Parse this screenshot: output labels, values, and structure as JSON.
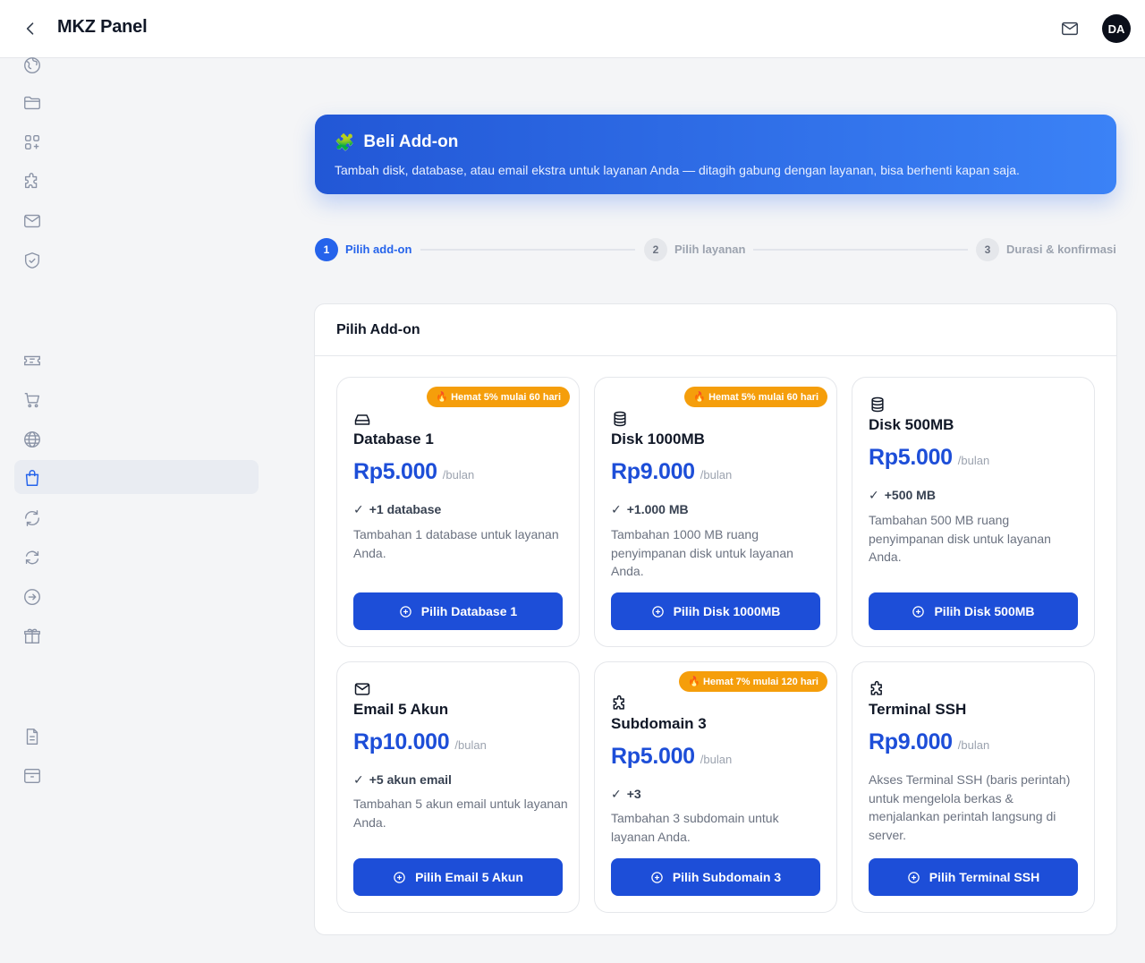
{
  "header": {
    "title": "MKZ Panel",
    "avatar_initials": "DA"
  },
  "sidebar": {
    "icons": [
      "globe-icon",
      "folder-icon",
      "apps-icon",
      "puzzle-icon",
      "mail-icon",
      "shield-icon",
      "ticket-icon",
      "cart-icon",
      "globe-icon",
      "shopping-bag-icon",
      "refresh-icon",
      "sync-icon",
      "arrow-right-circle-icon",
      "gift-icon",
      "document-icon",
      "archive-icon"
    ],
    "active_item": "shopping-bag-icon"
  },
  "hero": {
    "emoji": "🧩",
    "title": "Beli Add-on",
    "subtitle": "Tambah disk, database, atau email ekstra untuk layanan Anda — ditagih gabung dengan layanan, bisa berhenti kapan saja."
  },
  "stepper": {
    "steps": [
      {
        "number": "1",
        "label": "Pilih add-on",
        "state": "active"
      },
      {
        "number": "2",
        "label": "Pilih layanan",
        "state": "inactive"
      },
      {
        "number": "3",
        "label": "Durasi & konfirmasi",
        "state": "inactive"
      }
    ]
  },
  "panel": {
    "title": "Pilih Add-on",
    "cards": [
      {
        "icon": "drive-icon",
        "badge": "🔥 Hemat 5% mulai 60 hari",
        "name": "Database 1",
        "price": "Rp5.000",
        "per": "/bulan",
        "feature": "+1 database",
        "description": "Tambahan 1 database untuk layanan Anda.",
        "button": "Pilih Database 1"
      },
      {
        "icon": "database-icon",
        "badge": "🔥 Hemat 5% mulai 60 hari",
        "name": "Disk 1000MB",
        "price": "Rp9.000",
        "per": "/bulan",
        "feature": "+1.000 MB",
        "description": "Tambahan 1000 MB ruang penyimpanan disk untuk layanan Anda.",
        "button": "Pilih Disk 1000MB"
      },
      {
        "icon": "database-icon",
        "badge": "",
        "name": "Disk 500MB",
        "price": "Rp5.000",
        "per": "/bulan",
        "feature": "+500 MB",
        "description": "Tambahan 500 MB ruang penyimpanan disk untuk layanan Anda.",
        "button": "Pilih Disk 500MB"
      },
      {
        "icon": "mail-icon",
        "badge": "",
        "name": "Email 5 Akun",
        "price": "Rp10.000",
        "per": "/bulan",
        "feature": "+5 akun email",
        "description": "Tambahan 5 akun email untuk layanan Anda.",
        "button": "Pilih Email 5 Akun"
      },
      {
        "icon": "puzzle-icon",
        "badge": "🔥 Hemat 7% mulai 120 hari",
        "name": "Subdomain 3",
        "price": "Rp5.000",
        "per": "/bulan",
        "feature": "+3",
        "description": "Tambahan 3 subdomain untuk layanan Anda.",
        "button": "Pilih Subdomain 3"
      },
      {
        "icon": "puzzle-icon",
        "badge": "",
        "name": "Terminal SSH",
        "price": "Rp9.000",
        "per": "/bulan",
        "feature": "",
        "description": "Akses Terminal SSH (baris perintah) untuk mengelola berkas & menjalankan perintah langsung di server.",
        "button": "Pilih Terminal SSH"
      }
    ]
  },
  "colors": {
    "primary": "#1d4ed8",
    "accent": "#2563eb",
    "badge": "#f59e0b",
    "background": "#f4f5f7"
  }
}
